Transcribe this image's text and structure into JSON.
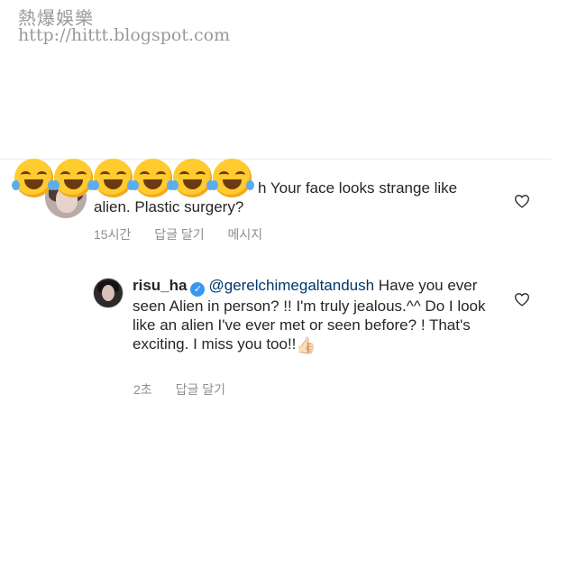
{
  "watermark": {
    "title": "熱爆娛樂",
    "url": "http://hittt.blogspot.com"
  },
  "comment": {
    "text_line1": "h Your face looks strange like",
    "text_line2": "alien. Plastic surgery?",
    "time": "15시간",
    "reply_label": "답글 달기",
    "message_label": "메시지",
    "emoji_count": 6,
    "emoji_icon": "face-with-tears-of-joy"
  },
  "reply": {
    "username": "risu_ha",
    "verified_icon": "verified-badge",
    "mention": "@gerelchimegaltandush",
    "text": " Have you ever seen Alien in person? !! I'm truly jealous.^^ Do I look like an alien I've ever met or seen before? ! That's exciting. I miss you too!!",
    "emoji": "👍🏻",
    "time": "2초",
    "reply_label": "답글 달기"
  },
  "icons": {
    "like": "heart-outline-icon",
    "color_accent": "#3897f0",
    "mention_color": "#00376b",
    "meta_color": "#8e8e8e"
  }
}
